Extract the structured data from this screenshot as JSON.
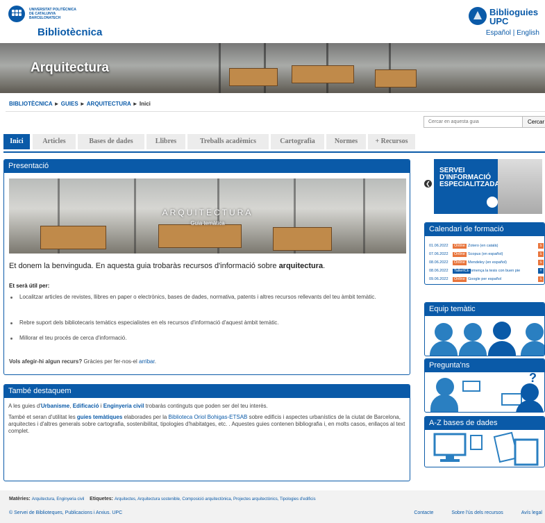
{
  "header": {
    "university": "UNIVERSITAT POLITÈCNICA\nDE CATALUNYA\nBARCELONATECH",
    "site_title": "Bibliotècnica",
    "guides_logo_line1": "Biblioguies",
    "guides_logo_line2": "UPC",
    "lang_es": "Español",
    "lang_sep": "|",
    "lang_en": "English"
  },
  "banner": {
    "title": "Arquitectura"
  },
  "breadcrumb": {
    "items": [
      "BIBLIOTÈCNICA",
      "GUIES",
      "ARQUITECTURA"
    ],
    "sep": "►",
    "current": "Inici"
  },
  "search": {
    "placeholder": "Cercar en aquesta guia",
    "button": "Cercar"
  },
  "tabs": [
    "Inici",
    "Articles",
    "Bases de dades",
    "Llibres",
    "Treballs acadèmics",
    "Cartografia",
    "Normes",
    "+ Recursos"
  ],
  "presentacio": {
    "title": "Presentació",
    "hero_title": "ARQUITECTURA",
    "hero_subtitle": "Guia temàtica",
    "welcome_pre": "Et donem la benvinguda. En aquesta guia trobaràs recursos d'informació sobre ",
    "welcome_bold": "arquitectura",
    "welcome_post": ".",
    "useful_for": "Et serà útil per:",
    "bullets": [
      "Localitzar articles de revistes, llibres en paper o electrònics, bases de dades, normativa, patents i altres recursos rellevants del teu àmbit temàtic.",
      "Rebre suport dels bibliotecaris temàtics especialistes en els recursos d'informació d'aquest àmbit temàtic.",
      "Millorar el teu procés de cerca d'informació."
    ],
    "add_question": "Vols afegir-hi algun recurs?",
    "add_text": " Gràcies per fer-nos-el ",
    "add_link": "arribar",
    "add_end": "."
  },
  "tambe": {
    "title": "També destaquem",
    "p1_a": "A les guies d'",
    "p1_l1": "Urbanisme",
    "p1_b": ", ",
    "p1_l2": "Edificació",
    "p1_c": " i ",
    "p1_l3": "Enginyeria civil",
    "p1_d": " trobaràs continguts que poden ser del teu interès.",
    "p2_a": "També et seran d'utilitat les ",
    "p2_l1": "guies temàtiques",
    "p2_b": " elaborades per la ",
    "p2_l2": "Biblioteca Oriol Bohigas-ETSAB",
    "p2_c": " sobre edificis i aspectes urbanístics de la ciutat de Barcelona, arquitectes i d'altres generals sobre cartografia, sostenibilitat, tipologies d'habitatges, etc. . Aquestes guies contenen bibliografia i, en molts casos, enllaços al text complet."
  },
  "carousel": {
    "text": "SERVEI\nD'INFORMACIÓ\nESPECIALITZADA",
    "arrow": "❮"
  },
  "calendar": {
    "title": "Calendari de formació",
    "rows": [
      {
        "date": "01.06.2022",
        "tag": "Online",
        "text": "Zotero (en català)",
        "mark": "s"
      },
      {
        "date": "07.06.2022",
        "tag": "Online",
        "text": "Scopus (en español)",
        "mark": "s"
      },
      {
        "date": "08.06.2022",
        "tag": "Online",
        "text": "Mendeley (en español)",
        "mark": "s"
      },
      {
        "date": "08.06.2022",
        "tag": "TallerICE",
        "text": "Comença la tesis con buen pie",
        "mark": "+"
      },
      {
        "date": "09.06.2022",
        "tag": "Online",
        "text": "Google per español",
        "mark": "s"
      }
    ]
  },
  "team": {
    "title": "Equip temàtic"
  },
  "ask": {
    "title": "Pregunta'ns"
  },
  "az": {
    "title": "A-Z bases de dades"
  },
  "footer": {
    "subjects_label": "Matèries:",
    "subjects": "Arquitectura, Enginyeria civil",
    "tags_label": "Etiquetes:",
    "tags": "Arquitectes, Arquitectura sostenible, Composició arquitectònica, Projectes arquitectònics, Tipologies d'edificis",
    "copyright": "© Servei de Biblioteques, Publicacions i Arxius. UPC",
    "contact": "Contacte",
    "usage": "Sobre l'ús dels recursos",
    "legal": "Avís legal"
  },
  "colors": {
    "brand": "#0a5aa8",
    "accent": "#e8743b"
  }
}
